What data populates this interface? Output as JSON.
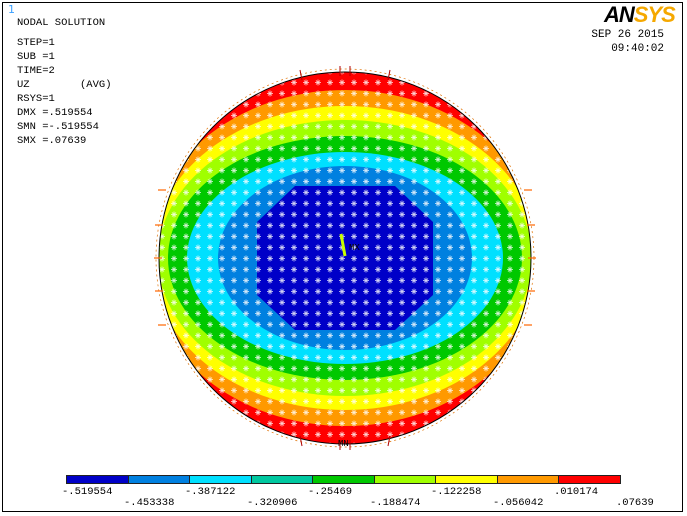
{
  "window": {
    "index": "1"
  },
  "logo": {
    "part1": "AN",
    "part2": "SYS"
  },
  "info": {
    "title": "NODAL SOLUTION",
    "step": "STEP=1",
    "sub": "SUB =1",
    "time": "TIME=2",
    "component": "UZ",
    "avg": "(AVG)",
    "rsys": "RSYS=1",
    "dmx": "DMX =.519554",
    "smn": "SMN =-.519554",
    "smx": "SMX =.07639"
  },
  "datetime": {
    "date": "SEP 26 2015",
    "time": "09:40:02"
  },
  "markers": {
    "mn": "MN"
  },
  "legend": {
    "colors": [
      "#0000c8",
      "#0080e0",
      "#00e0ff",
      "#00c8a0",
      "#00c800",
      "#a0ff00",
      "#ffff00",
      "#ff9900",
      "#ff0000"
    ],
    "upper_labels": [
      "-.519554",
      "-.387122",
      "-.25469",
      "-.122258",
      ".010174"
    ],
    "lower_labels": [
      "-.453338",
      "-.320906",
      "-.188474",
      "-.056042",
      ".07639"
    ]
  }
}
